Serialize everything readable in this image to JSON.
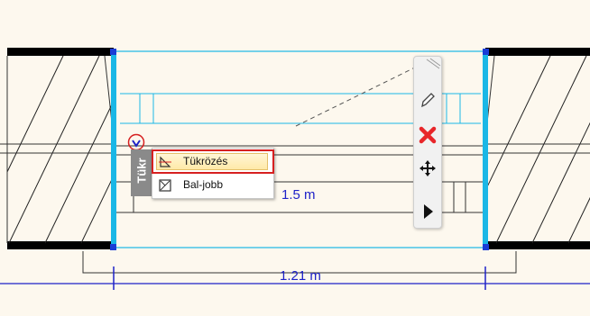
{
  "dimensions": {
    "inner_width": "1.5 m",
    "outer_width": "1.21 m"
  },
  "side_tab": {
    "label": "Tükr"
  },
  "context_menu": {
    "items": [
      {
        "label": "Tükrözés",
        "icon": "mirror-icon",
        "highlighted": true
      },
      {
        "label": "Bal-jobb",
        "icon": "left-right-icon",
        "highlighted": false
      }
    ]
  },
  "toolbar": {
    "buttons": [
      {
        "icon": "pencil-icon"
      },
      {
        "icon": "delete-icon",
        "color": "#e8262a"
      },
      {
        "icon": "move-icon"
      },
      {
        "icon": "play-icon"
      }
    ]
  },
  "colors": {
    "background": "#fdf8ee",
    "selection": "#1ab7e6",
    "dimension": "#1e22c8",
    "highlight_outline": "#d62020"
  }
}
